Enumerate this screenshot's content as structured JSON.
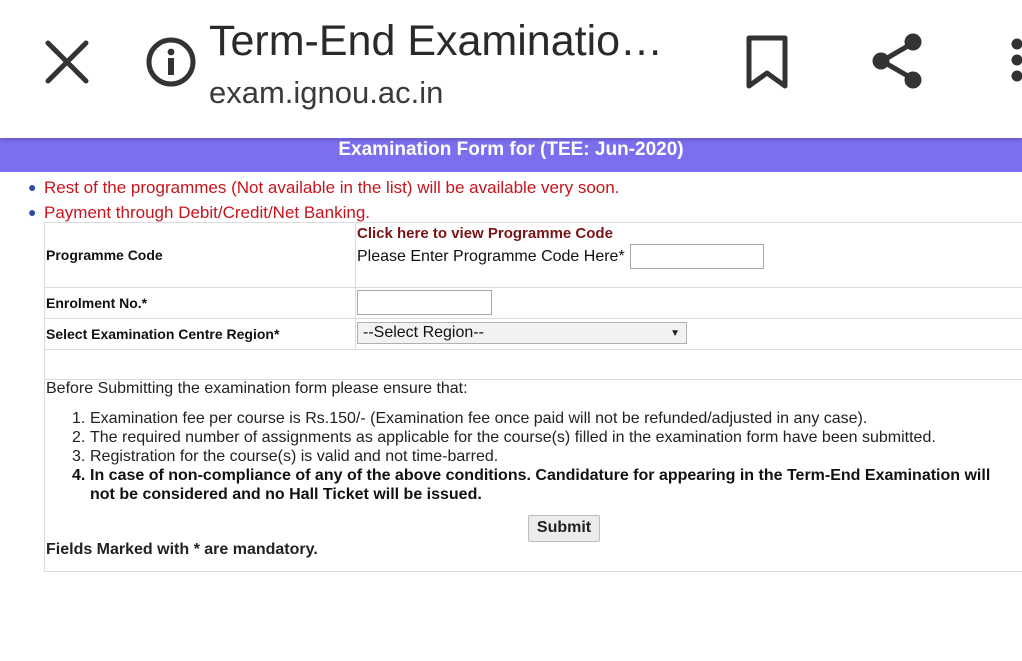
{
  "browser": {
    "title": "Term-End Examinatio…",
    "url": "exam.ignou.ac.in",
    "icons": [
      "close-icon",
      "info-icon",
      "bookmark-icon",
      "share-icon",
      "more-vert-icon"
    ]
  },
  "banner": {
    "text": "Examination Form for (TEE: Jun-2020)",
    "color": "#7b6ff0"
  },
  "notices": [
    "Rest of the programmes (Not available in the list) will be available very soon.",
    "Payment through Debit/Credit/Net Banking."
  ],
  "form": {
    "programme": {
      "label": "Programme Code",
      "link": "Click here to view Programme Code",
      "prompt": "Please Enter Programme Code Here*",
      "value": ""
    },
    "enrolment": {
      "label": "Enrolment No.*",
      "value": ""
    },
    "region": {
      "label": "Select Examination Centre Region*",
      "selected": "--Select Region--"
    }
  },
  "instructions": {
    "intro": "Before Submitting the examination form please ensure that:",
    "items": [
      {
        "num": "1.",
        "text": "Examination fee per course is Rs.150/- (Examination fee once paid will not be refunded/adjusted in any case)."
      },
      {
        "num": "2.",
        "text": "The required number of assignments as applicable for the course(s) filled in the examination form have been submitted."
      },
      {
        "num": "3.",
        "text": "Registration for the course(s) is valid and not time-barred."
      },
      {
        "num": "4.",
        "text": "In case of non-compliance of any of the above conditions. Candidature for appearing in the Term-End Examination will not be considered and no Hall Ticket will be issued."
      }
    ],
    "submit_label": "Submit",
    "mandatory_note": "Fields Marked with * are mandatory."
  },
  "colors": {
    "notice_red": "#c8141c",
    "link_maroon": "#7a1414"
  }
}
